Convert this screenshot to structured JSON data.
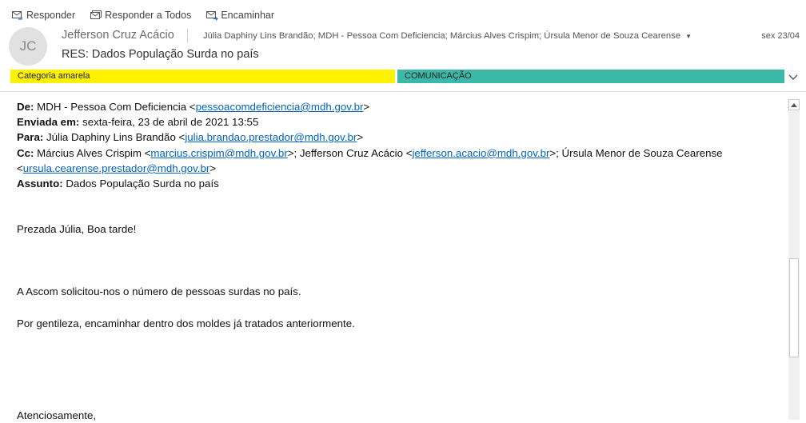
{
  "toolbar": {
    "reply": "Responder",
    "reply_all": "Responder a Todos",
    "forward": "Encaminhar"
  },
  "header": {
    "avatar_initials": "JC",
    "sender": "Jefferson Cruz Acácio",
    "recipients": "Júlia Daphiny Lins Brandão; MDH - Pessoa Com Deficiencia; Március Alves Crispim; Úrsula Menor de Souza Cearense",
    "date": "sex 23/04",
    "subject": "RES: Dados População Surda no país"
  },
  "categories": [
    {
      "label": "Categoria amarela",
      "color": "#fff200"
    },
    {
      "label": "COMUNICAÇÃO",
      "color": "#3cb8a8"
    }
  ],
  "message": {
    "from_label": "De:",
    "from_name": "MDH - Pessoa Com Deficiencia <",
    "from_email": "pessoacomdeficiencia@mdh.gov.br",
    "sent_label": "Enviada em:",
    "sent_value": "sexta-feira, 23 de abril de 2021 13:55",
    "to_label": "Para:",
    "to_name": "Júlia Daphiny Lins Brandão <",
    "to_email": "julia.brandao.prestador@mdh.gov.br",
    "cc_label": "Cc:",
    "cc_name1": "Március Alves Crispim <",
    "cc_email1": "marcius.crispim@mdh.gov.br",
    "cc_name2": ">; Jefferson Cruz Acácio <",
    "cc_email2": "jefferson.acacio@mdh.gov.br",
    "cc_name3": ">; Úrsula Menor de Souza Cearense",
    "cc_email3": "ursula.cearense.prestador@mdh.gov.br",
    "subject_label": "Assunto:",
    "subject_value": "Dados População Surda no país",
    "greeting": "Prezada Júlia, Boa tarde!",
    "line1": "A Ascom solicitou-nos o número de pessoas surdas no país.",
    "line2": "Por gentileza, encaminhar dentro dos moldes já tratados anteriormente.",
    "closing": "Atenciosamente,"
  }
}
